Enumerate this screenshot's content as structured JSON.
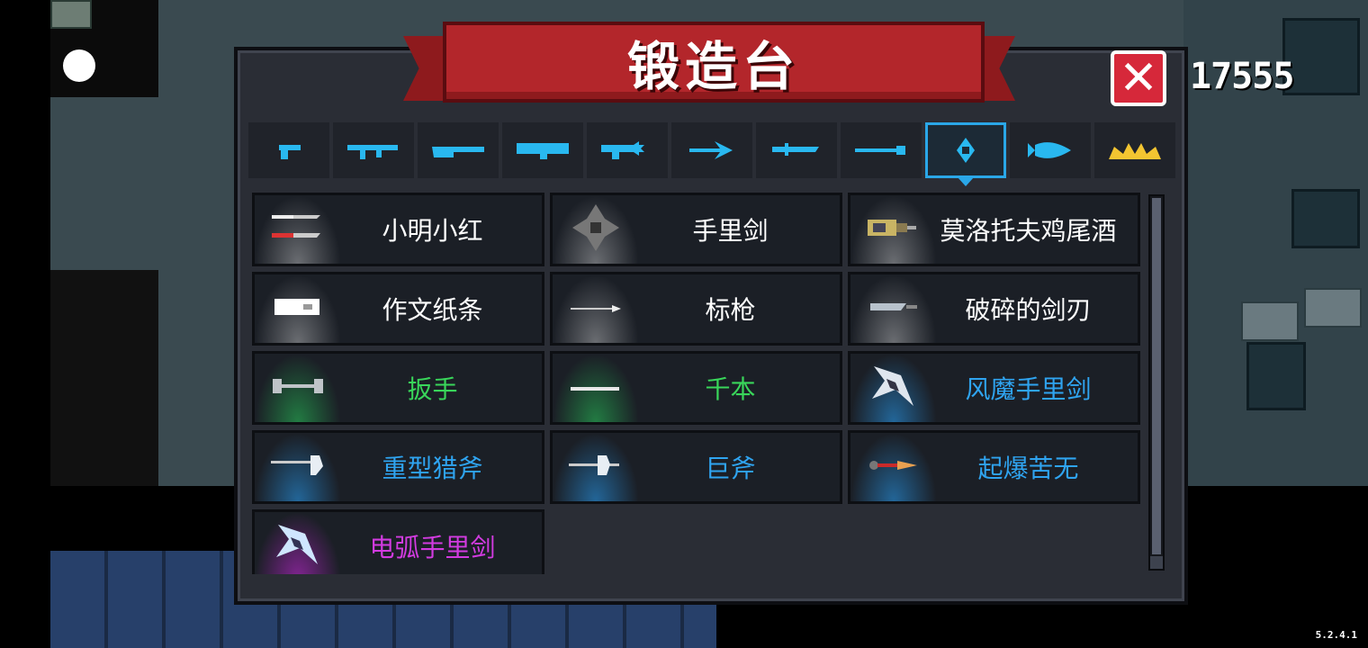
{
  "forge": {
    "title": "锻造台",
    "close_label": "✕",
    "gems": "17555"
  },
  "tabs": [
    {
      "icon": "pistol-icon"
    },
    {
      "icon": "rifle-icon"
    },
    {
      "icon": "shotgun-icon"
    },
    {
      "icon": "launcher-icon"
    },
    {
      "icon": "laser-icon"
    },
    {
      "icon": "bow-icon"
    },
    {
      "icon": "melee-icon"
    },
    {
      "icon": "staff-icon"
    },
    {
      "icon": "throwing-icon",
      "selected": true
    },
    {
      "icon": "fish-icon"
    },
    {
      "icon": "crown-icon"
    }
  ],
  "items": [
    {
      "name": "小明小红",
      "rarity": "white",
      "icon": "twin-knives-icon"
    },
    {
      "name": "手里剑",
      "rarity": "white",
      "icon": "shuriken-icon"
    },
    {
      "name": "莫洛托夫鸡尾酒",
      "rarity": "white",
      "icon": "molotov-icon"
    },
    {
      "name": "作文纸条",
      "rarity": "white",
      "icon": "paper-note-icon"
    },
    {
      "name": "标枪",
      "rarity": "white",
      "icon": "javelin-icon"
    },
    {
      "name": "破碎的剑刃",
      "rarity": "white",
      "icon": "broken-blade-icon"
    },
    {
      "name": "扳手",
      "rarity": "green",
      "icon": "wrench-icon"
    },
    {
      "name": "千本",
      "rarity": "green",
      "icon": "senbon-icon"
    },
    {
      "name": "风魔手里剑",
      "rarity": "blue",
      "icon": "fuma-shuriken-icon"
    },
    {
      "name": "重型猎斧",
      "rarity": "blue",
      "icon": "heavy-axe-icon"
    },
    {
      "name": "巨斧",
      "rarity": "blue",
      "icon": "giant-axe-icon"
    },
    {
      "name": "起爆苦无",
      "rarity": "blue",
      "icon": "explosive-kunai-icon"
    },
    {
      "name": "电弧手里剑",
      "rarity": "purple",
      "icon": "arc-shuriken-icon"
    }
  ],
  "version": "5.2.4.1",
  "colors": {
    "accent_blue": "#2aa7e8",
    "banner_red": "#b3262b",
    "close_red": "#d6283a",
    "rarity_green": "#39d65a",
    "rarity_blue": "#2fa4f0",
    "rarity_purple": "#d23be0"
  }
}
